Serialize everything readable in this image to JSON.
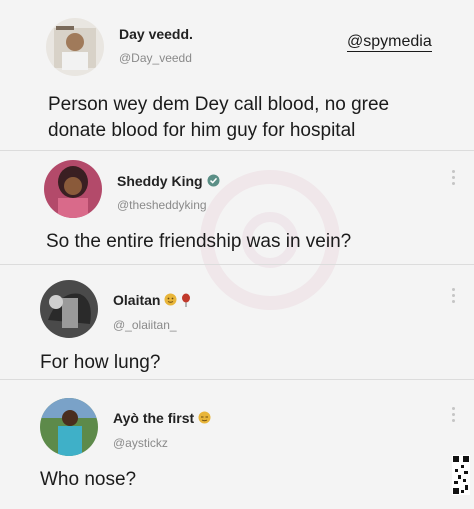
{
  "watermark_handle": "@spymedia",
  "posts": [
    {
      "name": "Day veedd.",
      "handle": "@Day_veedd",
      "text": "Person wey dem Dey call blood, no gree donate blood for him guy for hospital"
    },
    {
      "name": "Sheddy King",
      "handle": "@thesheddyking",
      "text": "So the entire friendship was in vein?"
    },
    {
      "name": "Olaitan",
      "handle": "@_olaiitan_",
      "text": "For how lung?"
    },
    {
      "name": "Ayò the first",
      "handle": "@aystickz",
      "text": "Who nose?"
    }
  ],
  "colors": {
    "background": "#f4f4f4",
    "verified_badge": "#5b8f86",
    "emoji": "#e8b53a",
    "balloon": "#c0392b"
  },
  "icons": [
    "more-options-icon",
    "verified-badge-icon",
    "emoji-icon",
    "balloon-icon",
    "qr-code-icon"
  ]
}
